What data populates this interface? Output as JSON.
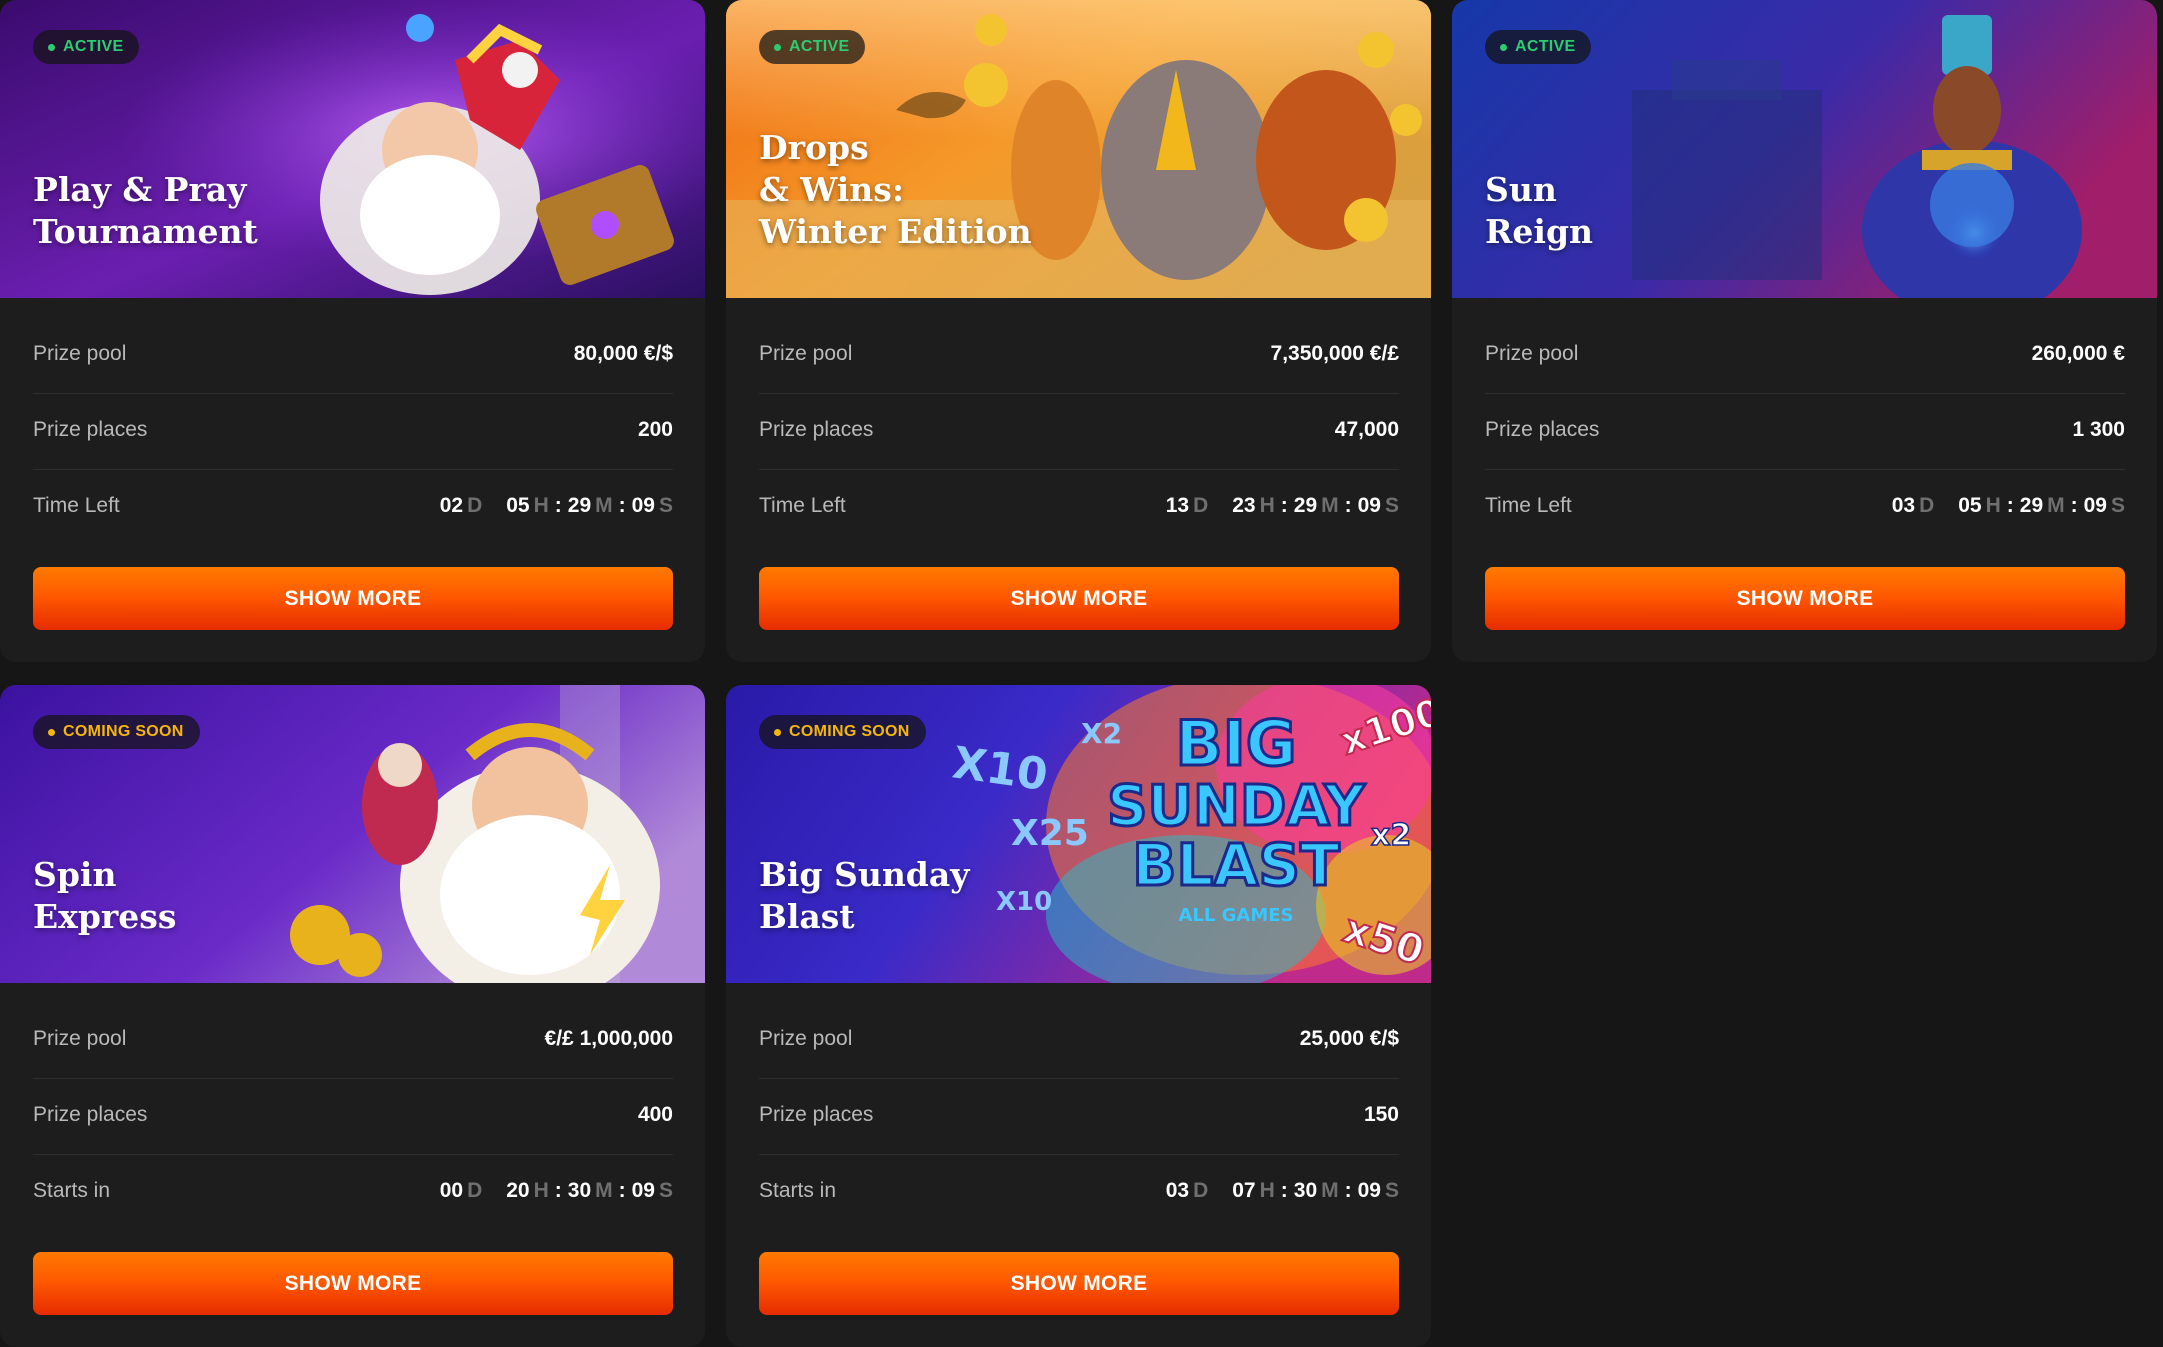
{
  "colors": {
    "page_background": "#161616",
    "card_background": "#1d1d1d",
    "accent_button": "#ff5a00",
    "active_badge": "#2ecc71",
    "coming_soon_badge": "#f5b60a"
  },
  "cards": [
    {
      "status": "ACTIVE",
      "title": "Play & Pray\nTournament",
      "rows": [
        {
          "label": "Prize pool",
          "value": "80,000 €/$"
        },
        {
          "label": "Prize places",
          "value": "200"
        }
      ],
      "timer_label": "Time Left",
      "timer": {
        "d": "02",
        "h": "05",
        "m": "29",
        "s": "09"
      },
      "button": "SHOW MORE"
    },
    {
      "status": "ACTIVE",
      "title": "Drops\n& Wins:\nWinter Edition",
      "rows": [
        {
          "label": "Prize pool",
          "value": "7,350,000 €/£"
        },
        {
          "label": "Prize places",
          "value": "47,000"
        }
      ],
      "timer_label": "Time Left",
      "timer": {
        "d": "13",
        "h": "23",
        "m": "29",
        "s": "09"
      },
      "button": "SHOW MORE"
    },
    {
      "status": "ACTIVE",
      "title": "Sun\nReign",
      "rows": [
        {
          "label": "Prize pool",
          "value": "260,000 €"
        },
        {
          "label": "Prize places",
          "value": "1 300"
        }
      ],
      "timer_label": "Time Left",
      "timer": {
        "d": "03",
        "h": "05",
        "m": "29",
        "s": "09"
      },
      "button": "SHOW MORE"
    },
    {
      "status": "COMING SOON",
      "title": "Spin\nExpress",
      "rows": [
        {
          "label": "Prize pool",
          "value": "€/£ 1,000,000"
        },
        {
          "label": "Prize places",
          "value": "400"
        }
      ],
      "timer_label": "Starts in",
      "timer": {
        "d": "00",
        "h": "20",
        "m": "30",
        "s": "09"
      },
      "button": "SHOW MORE"
    },
    {
      "status": "COMING SOON",
      "title": "Big Sunday\nBlast",
      "rows": [
        {
          "label": "Prize pool",
          "value": "25,000 €/$"
        },
        {
          "label": "Prize places",
          "value": "150"
        }
      ],
      "timer_label": "Starts in",
      "timer": {
        "d": "03",
        "h": "07",
        "m": "30",
        "s": "09"
      },
      "button": "SHOW MORE"
    }
  ],
  "timer_units": {
    "d": "D",
    "h": "H",
    "m": "M",
    "s": "S"
  },
  "banner_art": {
    "big_sunday_blast": {
      "logo_lines": [
        "BIG",
        "SUNDAY",
        "BLAST"
      ],
      "logo_sub": "ALL GAMES",
      "multipliers": [
        "X10",
        "X2",
        "x100",
        "X25",
        "x2",
        "X10",
        "x50"
      ]
    }
  }
}
